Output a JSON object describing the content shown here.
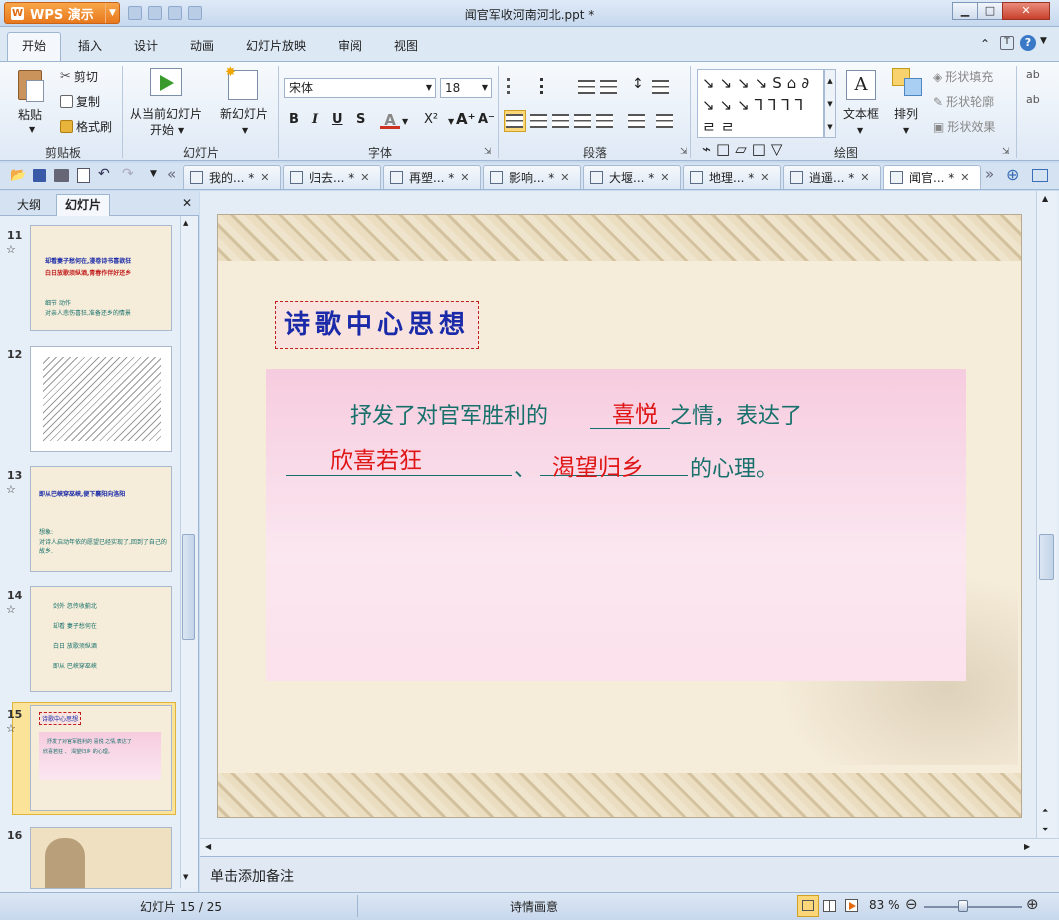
{
  "app": {
    "name": "WPS 演示",
    "window_title": "闻官军收河南河北.ppt *"
  },
  "menu": [
    "开始",
    "插入",
    "设计",
    "动画",
    "幻灯片放映",
    "审阅",
    "视图"
  ],
  "ribbon": {
    "clipboard": {
      "paste": "粘贴",
      "cut": "剪切",
      "copy": "复制",
      "format_painter": "格式刷",
      "group": "剪贴板"
    },
    "slides": {
      "from_current": "从当前幻灯片",
      "from_current_2": "开始",
      "new_slide": "新幻灯片",
      "group": "幻灯片"
    },
    "font": {
      "name": "宋体",
      "size": "18",
      "group": "字体",
      "bold": "B",
      "italic": "I",
      "underline": "U",
      "shadow": "S"
    },
    "paragraph": {
      "group": "段落"
    },
    "drawing": {
      "textbox": "文本框",
      "arrange": "排列",
      "shape_fill": "形状填充",
      "shape_outline": "形状轮廓",
      "shape_effect": "形状效果",
      "group": "绘图"
    }
  },
  "doc_tabs": [
    "我的... *",
    "归去... *",
    "再塑... *",
    "影响... *",
    "大堰... *",
    "地理... *",
    "逍遥... *",
    "闻官... *"
  ],
  "left_pane": {
    "tabs": [
      "大纲",
      "幻灯片"
    ],
    "thumbs": [
      {
        "num": "11",
        "lines": [
          "却看妻子愁何在,漫卷诗书喜欲狂",
          "白日放歌须纵酒,青春作伴好还乡",
          "细节 动作",
          "对亲人悲伤喜狂,准备还乡的情景"
        ]
      },
      {
        "num": "12",
        "lines": []
      },
      {
        "num": "13",
        "lines": [
          "即从巴峡穿巫峡,便下襄阳向洛阳",
          "想象:",
          "对诗人启动年依的愿望已经实现了,回到了自己的故乡."
        ]
      },
      {
        "num": "14",
        "lines": [
          "剑外 忽传收蓟北",
          "却看 妻子愁何在",
          "白日 放歌须纵酒",
          "即从 巴峡穿巫峡"
        ]
      },
      {
        "num": "15",
        "lines": [
          "诗歌中心思想",
          "抒发了对官军胜利的 喜悦 之情,表达了",
          "欣喜若狂 、 渴望归乡 的心理。"
        ]
      },
      {
        "num": "16",
        "lines": []
      }
    ]
  },
  "slide": {
    "title": "诗歌中心思想",
    "line1_prefix": "抒发了对官军胜利的",
    "line1_suffix": "之情，表达了",
    "line2_sep": "、",
    "line2_suffix": "的心理。",
    "answers": [
      "喜悦",
      "欣喜若狂",
      "渴望归乡"
    ]
  },
  "notes_placeholder": "单击添加备注",
  "status": {
    "slide_counter": "幻灯片 15 / 25",
    "theme": "诗情画意",
    "zoom": "83 %"
  }
}
